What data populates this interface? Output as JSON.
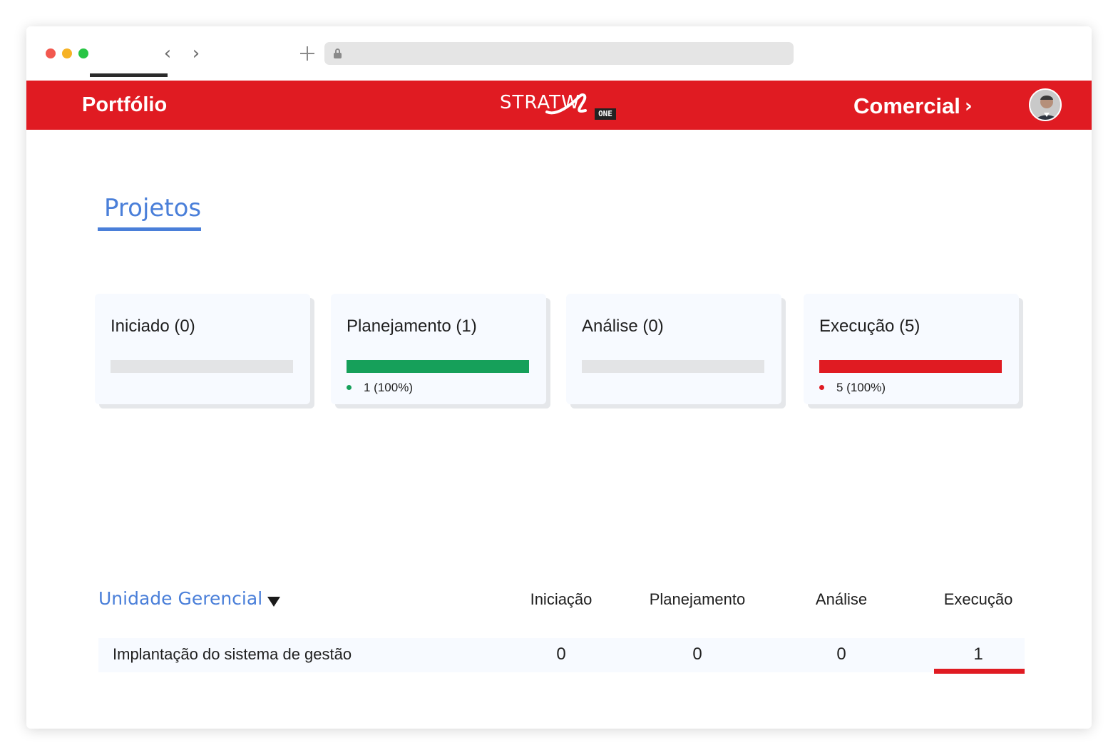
{
  "header": {
    "portfolio_label": "Portfólio",
    "logo_text": "STRATW",
    "logo_badge": "ONE",
    "comercial_label": "Comercial",
    "chevron": "›"
  },
  "page": {
    "title": "Projetos"
  },
  "cards": [
    {
      "title": "Iniciado (0)",
      "fraction": 0,
      "legend": "",
      "color": ""
    },
    {
      "title": "Planejamento (1)",
      "fraction": 1.0,
      "legend": "1 (100%)",
      "color": "#16a05a"
    },
    {
      "title": "Análise (0)",
      "fraction": 0,
      "legend": "",
      "color": ""
    },
    {
      "title": "Execução (5)",
      "fraction": 1.0,
      "legend": "5 (100%)",
      "color": "#e01b22"
    }
  ],
  "table": {
    "group_label": "Unidade Gerencial",
    "columns": [
      "Iniciação",
      "Planejamento",
      "Análise",
      "Execução"
    ],
    "rows": [
      {
        "name": "Implantação do sistema de gestão",
        "values": [
          "0",
          "0",
          "0",
          "1"
        ]
      }
    ]
  },
  "colors": {
    "brand_red": "#e01b22",
    "accent_blue": "#4a7fd9",
    "success_green": "#16a05a"
  }
}
